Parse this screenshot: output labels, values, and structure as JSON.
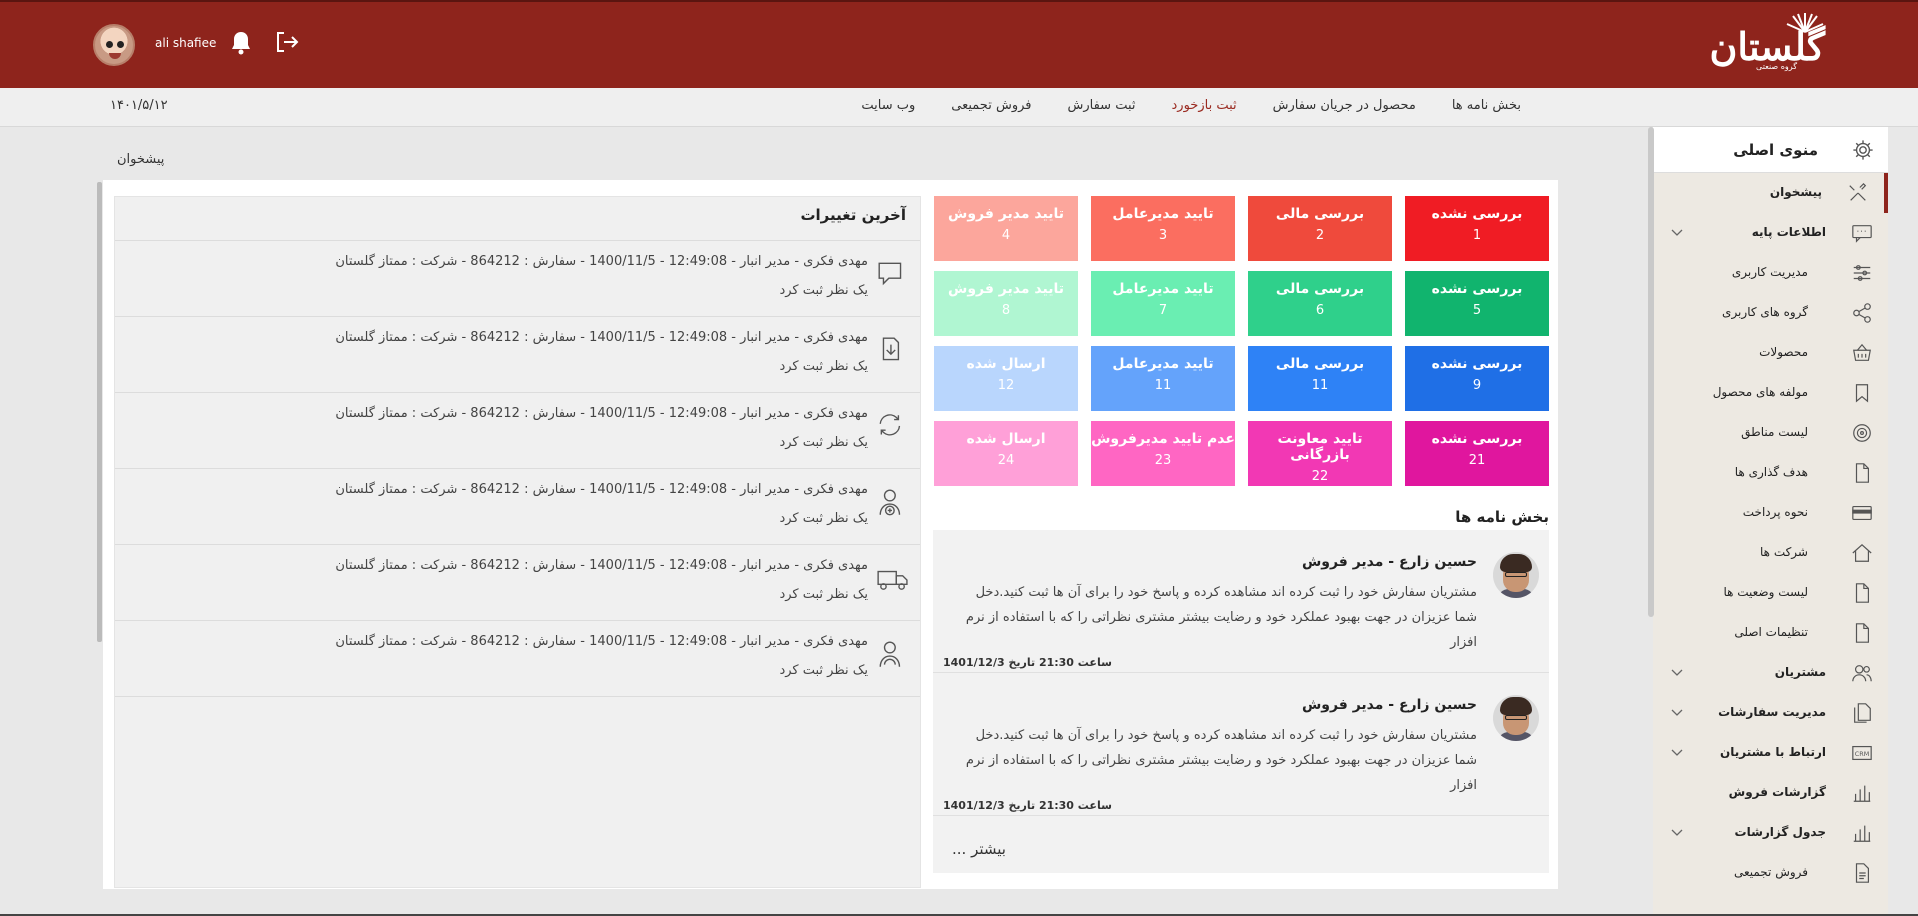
{
  "header": {
    "username": "ali shafiee",
    "logo_text": "گلستان",
    "logo_subtitle": "گروه صنعتی",
    "colors": {
      "brand": "#8e241c"
    },
    "icons": [
      "user-avatar",
      "bell-icon",
      "logout-icon"
    ]
  },
  "navbar": {
    "date": "۱۴۰۱/۵/۱۲",
    "links": [
      "وب سایت",
      "فروش تجمیعی",
      "ثبت سفارش",
      "ثبت بازخورد",
      "محصول در جریان سفارش",
      "بخش نامه ها"
    ],
    "active_link": "ثبت بازخورد"
  },
  "breadcrumb": "پیشخوان",
  "sidebar": {
    "title": "منوی اصلی",
    "items": [
      {
        "label": "پیشخوان",
        "icon": "tools-icon"
      },
      {
        "label": "اطلاعات پایه",
        "icon": "chat-box-icon"
      },
      {
        "label": "مدیریت کاربری",
        "icon": "sliders-icon"
      },
      {
        "label": "گروه های کاربری",
        "icon": "share-icon"
      },
      {
        "label": "محصولات",
        "icon": "basket-icon"
      },
      {
        "label": "مولفه های محصول",
        "icon": "bookmark-icon"
      },
      {
        "label": "لیست مناطق",
        "icon": "target-icon"
      },
      {
        "label": "هدف گذاری ها",
        "icon": "document-icon"
      },
      {
        "label": "نحوه پرداخت",
        "icon": "card-icon"
      },
      {
        "label": "شرکت ها",
        "icon": "house-icon"
      },
      {
        "label": "لیست وضعیت ها",
        "icon": "document-icon"
      },
      {
        "label": "تنظیمات اصلی",
        "icon": "document-icon"
      },
      {
        "label": "مشتریان",
        "icon": "users-icon"
      },
      {
        "label": "مدیریت سفارشات",
        "icon": "documents-icon"
      },
      {
        "label": "ارتباط با مشتریان",
        "icon": "crm-icon"
      },
      {
        "label": "گزارشات فروش",
        "icon": "bar-chart-icon"
      },
      {
        "label": "جدول گزارشات",
        "icon": "bar-chart-icon"
      },
      {
        "label": "فروش تجمیعی",
        "icon": "report-icon"
      }
    ]
  },
  "changes": {
    "title": "آخرین تغییرات",
    "rows": [
      {
        "line1": "مهدی فکری - مدیر انبار - 12:49:08 - 1400/11/5 - سفارش : 864212 - شرکت : ممتاز گلستان",
        "line2": "یک نظر ثبت کرد",
        "icon": "comment-icon"
      },
      {
        "line1": "مهدی فکری - مدیر انبار - 12:49:08 - 1400/11/5 - سفارش : 864212 - شرکت : ممتاز گلستان",
        "line2": "یک نظر ثبت کرد",
        "icon": "download-doc-icon"
      },
      {
        "line1": "مهدی فکری - مدیر انبار - 12:49:08 - 1400/11/5 - سفارش : 864212 - شرکت : ممتاز گلستان",
        "line2": "یک نظر ثبت کرد",
        "icon": "refresh-icon"
      },
      {
        "line1": "مهدی فکری - مدیر انبار - 12:49:08 - 1400/11/5 - سفارش : 864212 - شرکت : ممتاز گلستان",
        "line2": "یک نظر ثبت کرد",
        "icon": "user-add-icon"
      },
      {
        "line1": "مهدی فکری - مدیر انبار - 12:49:08 - 1400/11/5 - سفارش : 864212 - شرکت : ممتاز گلستان",
        "line2": "یک نظر ثبت کرد",
        "icon": "truck-icon"
      },
      {
        "line1": "مهدی فکری - مدیر انبار - 12:49:08 - 1400/11/5 - سفارش : 864212 - شرکت : ممتاز گلستان",
        "line2": "یک نظر ثبت کرد",
        "icon": "user-sync-icon"
      }
    ]
  },
  "tiles": [
    {
      "title": "بررسی نشده",
      "count": "1",
      "color": "#f01c24"
    },
    {
      "title": "بررسی مالی",
      "count": "2",
      "color": "#ef4a3c"
    },
    {
      "title": "تایید مدیرعامل",
      "count": "3",
      "color": "#fb6e60"
    },
    {
      "title": "تایید مدیر فروش",
      "count": "4",
      "color": "#fca69c"
    },
    {
      "title": "بررسی نشده",
      "count": "5",
      "color": "#11b46e"
    },
    {
      "title": "بررسی مالی",
      "count": "6",
      "color": "#2fd08b"
    },
    {
      "title": "تایید مدیرعامل",
      "count": "7",
      "color": "#6aeeb2"
    },
    {
      "title": "تایید مدیر فروش",
      "count": "8",
      "color": "#b0f6d2"
    },
    {
      "title": "بررسی نشده",
      "count": "9",
      "color": "#1f6fe6"
    },
    {
      "title": "بررسی مالی",
      "count": "11",
      "color": "#2e82f6"
    },
    {
      "title": "تایید مدیرعامل",
      "count": "11",
      "color": "#64a3fb"
    },
    {
      "title": "ارسال شده",
      "count": "12",
      "color": "#b9d6fd"
    },
    {
      "title": "بررسی نشده",
      "count": "21",
      "color": "#e0169e"
    },
    {
      "title": "تایید معاونت بازرگانی",
      "count": "22",
      "color": "#f238b4"
    },
    {
      "title": "عدم تایید مدیرفروش",
      "count": "23",
      "color": "#ff66c3"
    },
    {
      "title": "ارسال شده",
      "count": "24",
      "color": "#ffa0d8"
    }
  ],
  "announcements": {
    "title": "بخش نامه ها",
    "items": [
      {
        "name": "حسین زارع - مدیر فروش",
        "body": "مشتریان سفارش خود را ثبت کرده اند مشاهده کرده و پاسخ خود را برای آن ها ثبت کنید.دخل شما عزیزان در جهت بهبود عملکرد خود و رضایت بیشتر مشتری نظراتی را که با استفاده از نرم افزار",
        "time": "ساعت 21:30 تاریخ 1401/12/3"
      },
      {
        "name": "حسین زارع - مدیر فروش",
        "body": "مشتریان سفارش خود را ثبت کرده اند مشاهده کرده و پاسخ خود را برای آن ها ثبت کنید.دخل شما عزیزان در جهت بهبود عملکرد خود و رضایت بیشتر مشتری نظراتی را که با استفاده از نرم افزار",
        "time": "ساعت 21:30 تاریخ 1401/12/3"
      }
    ],
    "more": "بیشتر ..."
  }
}
